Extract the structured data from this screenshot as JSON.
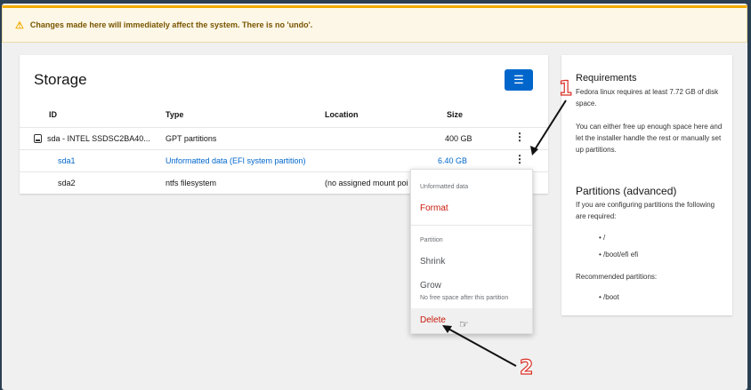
{
  "warning": {
    "icon": "warning-triangle-icon",
    "text": "Changes made here will immediately affect the system. There is no 'undo'."
  },
  "storage": {
    "title": "Storage",
    "menu_icon": "hamburger-icon",
    "columns": {
      "id": "ID",
      "type": "Type",
      "location": "Location",
      "size": "Size"
    },
    "rows": [
      {
        "id": "sda - INTEL SSDSC2BA40...",
        "type": "GPT partitions",
        "location": "",
        "size": "400 GB"
      },
      {
        "id": "sda1",
        "type": "Unformatted data (EFI system partition)",
        "location": "",
        "size": "6.40 GB"
      },
      {
        "id": "sda2",
        "type": "ntfs filesystem",
        "location": "(no assigned mount poi",
        "size": ""
      }
    ]
  },
  "dropdown": {
    "group1": "Unformatted data",
    "format": "Format",
    "group2": "Partition",
    "shrink": "Shrink",
    "grow": "Grow",
    "grow_desc": "No free space after this partition",
    "delete": "Delete"
  },
  "requirements": {
    "title": "Requirements",
    "text1": "Fedora linux requires at least 7.72 GB of disk space.",
    "text2": "You can either free up enough space here and let the installer handle the rest or manually set up partitions.",
    "partitions_title": "Partitions (advanced)",
    "partitions_text": "If you are configuring partitions the following are required:",
    "required": [
      "/",
      "/boot/efi efi"
    ],
    "recommended_label": "Recommended partitions:",
    "recommended": [
      "/boot"
    ]
  },
  "annotations": {
    "one": "1",
    "two": "2"
  },
  "colors": {
    "accent": "#0066cc",
    "danger": "#c9190b",
    "warning": "#f0ab00",
    "annotation": "#d93025"
  }
}
